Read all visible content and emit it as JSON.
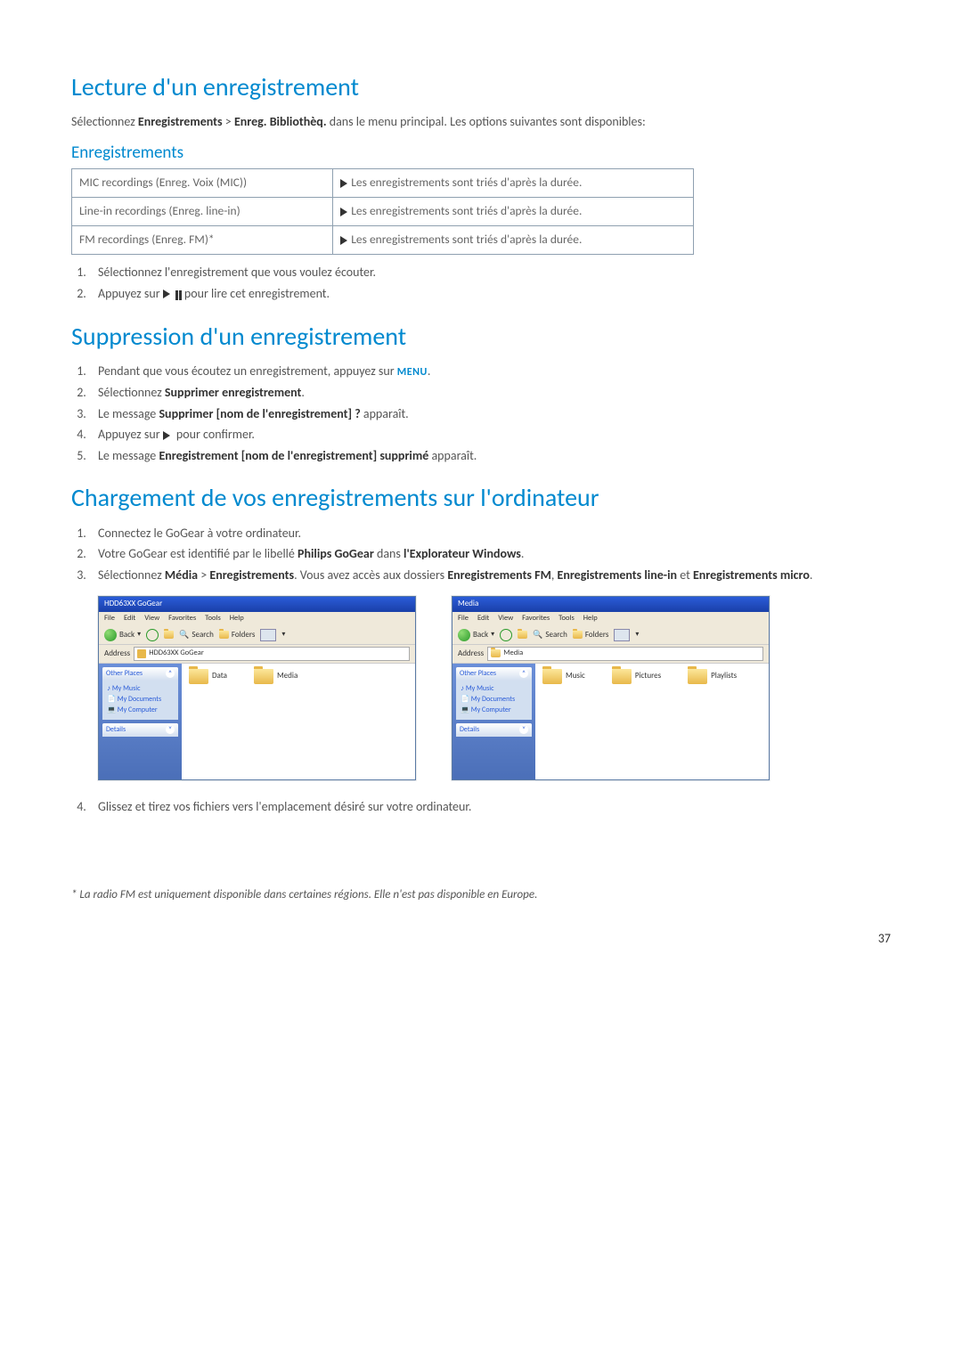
{
  "h1_lecture": "Lecture d'un enregistrement",
  "intro_parts": {
    "a": "Sélectionnez ",
    "b": "Enregistrements",
    "c": " > ",
    "d": "Enreg. Bibliothèq.",
    "e": " dans le menu principal. Les options suivantes sont disponibles:"
  },
  "h2_enreg": "Enregistrements",
  "table": {
    "r1l": "MIC recordings (Enreg. Voix (MIC))",
    "r1r": "Les enregistrements sont triés d'après la durée.",
    "r2l": "Line-in recordings (Enreg. line-in)",
    "r2r": "Les enregistrements sont triés d'après la durée.",
    "r3l": "FM recordings (Enreg. FM)*",
    "r3r": "Les enregistrements sont triés d'après la durée."
  },
  "steps_lecture": {
    "s1": "Sélectionnez l'enregistrement que vous voulez écouter.",
    "s2a": "Appuyez sur ",
    "s2b": " pour lire cet enregistrement."
  },
  "h1_suppr": "Suppression d'un enregistrement",
  "steps_suppr": {
    "s1a": "Pendant que vous écoutez un enregistrement, appuyez sur ",
    "s1b": "MENU",
    "s1c": ".",
    "s2a": "Sélectionnez ",
    "s2b": "Supprimer enregistrement",
    "s2c": ".",
    "s3a": "Le message ",
    "s3b": "Supprimer [nom de l'enregistrement] ?",
    "s3c": " apparaît.",
    "s4a": "Appuyez sur ",
    "s4b": " pour confirmer.",
    "s5a": "Le message ",
    "s5b": "Enregistrement [nom de l'enregistrement] supprimé",
    "s5c": " apparaît."
  },
  "h1_charge": "Chargement de vos enregistrements sur l'ordinateur",
  "steps_charge": {
    "s1": "Connectez le GoGear à votre ordinateur.",
    "s2a": "Votre GoGear est identifié par le libellé ",
    "s2b": "Philips GoGear",
    "s2c": " dans ",
    "s2d": "l'Explorateur Windows",
    "s2e": ".",
    "s3a": "Sélectionnez ",
    "s3b": "Média",
    "s3c": " > ",
    "s3d": "Enregistrements",
    "s3e": ". Vous avez accès aux dossiers ",
    "s3f": "Enregistrements FM",
    "s3g": ", ",
    "s3h": "Enregistrements line-in",
    "s3i": " et ",
    "s3j": "Enregistrements micro",
    "s3k": ".",
    "s4": "Glissez et tirez vos fichiers vers l'emplacement désiré sur votre ordinateur."
  },
  "explorer1": {
    "title": "HDD63XX GoGear",
    "menu": {
      "file": "File",
      "edit": "Edit",
      "view": "View",
      "fav": "Favorites",
      "tools": "Tools",
      "help": "Help"
    },
    "toolbar": {
      "back": "Back",
      "search": "Search",
      "folders": "Folders"
    },
    "addr_label": "Address",
    "addr_value": "HDD63XX GoGear",
    "panel1_title": "Other Places",
    "panel1_items": {
      "a": "My Music",
      "b": "My Documents",
      "c": "My Computer"
    },
    "panel2_title": "Details",
    "folders": {
      "a": "Data",
      "b": "Media"
    }
  },
  "explorer2": {
    "title": "Media",
    "menu": {
      "file": "File",
      "edit": "Edit",
      "view": "View",
      "fav": "Favorites",
      "tools": "Tools",
      "help": "Help"
    },
    "toolbar": {
      "back": "Back",
      "search": "Search",
      "folders": "Folders"
    },
    "addr_label": "Address",
    "addr_value": "Media",
    "panel1_title": "Other Places",
    "panel1_items": {
      "a": "My Music",
      "b": "My Documents",
      "c": "My Computer"
    },
    "panel2_title": "Details",
    "folders": {
      "a": "Music",
      "b": "Pictures",
      "c": "Playlists"
    }
  },
  "footnote": "* La radio FM est uniquement disponible dans certaines régions. Elle n'est pas disponible en Europe.",
  "pagenum": "37"
}
